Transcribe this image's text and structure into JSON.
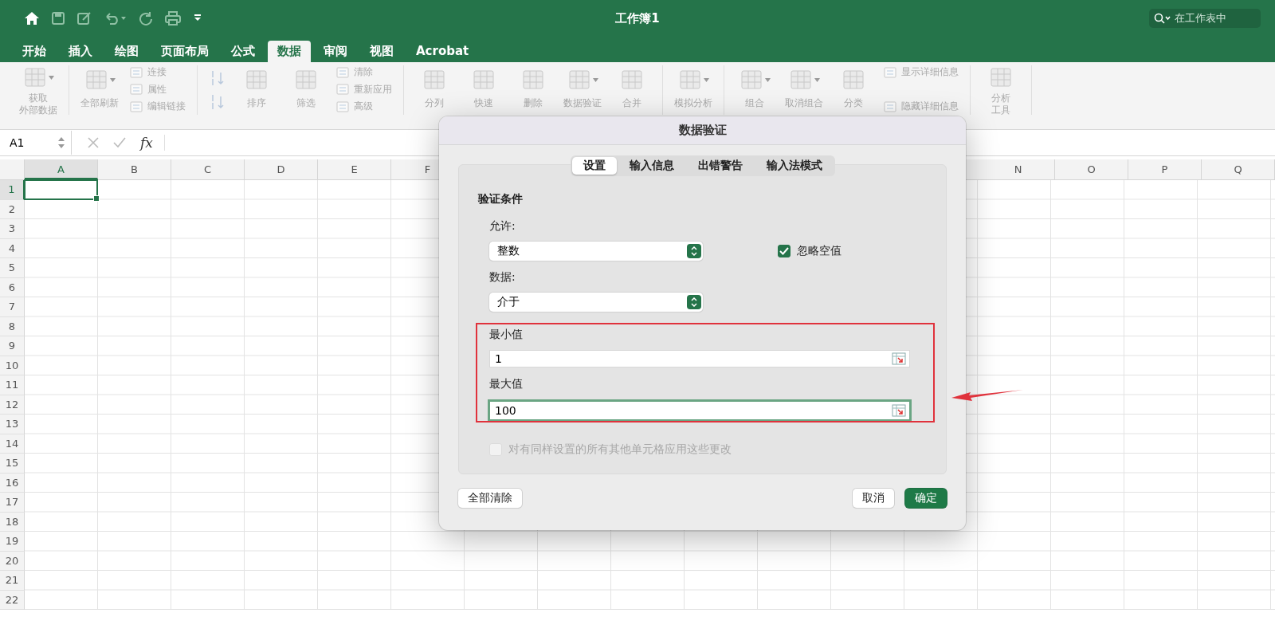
{
  "window": {
    "title": "工作簿1"
  },
  "search": {
    "placeholder": "在工作表中"
  },
  "tabs": [
    {
      "label": "开始",
      "selected": false
    },
    {
      "label": "插入",
      "selected": false
    },
    {
      "label": "绘图",
      "selected": false
    },
    {
      "label": "页面布局",
      "selected": false
    },
    {
      "label": "公式",
      "selected": false
    },
    {
      "label": "数据",
      "selected": true
    },
    {
      "label": "审阅",
      "selected": false
    },
    {
      "label": "视图",
      "selected": false
    },
    {
      "label": "Acrobat",
      "selected": false
    }
  ],
  "ribbon": {
    "disabled": true,
    "groups": [
      {
        "items": [
          {
            "kind": "large",
            "lines": [
              "获取",
              "外部数据"
            ],
            "menu": true
          }
        ]
      },
      {
        "items": [
          {
            "kind": "large",
            "lines": [
              "全部刷新"
            ],
            "menu": true
          },
          {
            "kind": "stack",
            "items": [
              "连接",
              "属性",
              "编辑链接"
            ]
          }
        ]
      },
      {
        "items": [
          {
            "kind": "sort-icons"
          },
          {
            "kind": "large",
            "lines": [
              "排序"
            ]
          },
          {
            "kind": "large",
            "lines": [
              "筛选"
            ]
          },
          {
            "kind": "stack",
            "items": [
              "清除",
              "重新应用",
              "高级"
            ]
          }
        ]
      },
      {
        "items": [
          {
            "kind": "large",
            "lines": [
              "分列"
            ]
          },
          {
            "kind": "large",
            "lines": [
              "快速"
            ]
          },
          {
            "kind": "large",
            "lines": [
              "删除"
            ]
          },
          {
            "kind": "large",
            "lines": [
              "数据验证"
            ],
            "menu": true
          },
          {
            "kind": "large",
            "lines": [
              "合并"
            ]
          }
        ]
      },
      {
        "items": [
          {
            "kind": "large",
            "lines": [
              "模拟分析"
            ],
            "menu": true
          }
        ]
      },
      {
        "items": [
          {
            "kind": "large",
            "lines": [
              "组合"
            ],
            "menu": true
          },
          {
            "kind": "large",
            "lines": [
              "取消组合"
            ],
            "menu": true
          },
          {
            "kind": "large",
            "lines": [
              "分类"
            ]
          },
          {
            "kind": "stack",
            "items": [
              "显示详细信息",
              "隐藏详细信息"
            ]
          }
        ]
      },
      {
        "items": [
          {
            "kind": "large",
            "lines": [
              "分析",
              "工具"
            ]
          }
        ]
      }
    ]
  },
  "formula_bar": {
    "name_box": "A1",
    "function_label": "fx"
  },
  "sheet": {
    "columns_left": [
      {
        "label": "A",
        "selected": true
      },
      {
        "label": "B",
        "selected": false
      },
      {
        "label": "C",
        "selected": false
      },
      {
        "label": "D",
        "selected": false
      },
      {
        "label": "E",
        "selected": false
      },
      {
        "label": "F",
        "selected": false
      }
    ],
    "columns_right": [
      {
        "label": "N",
        "selected": false
      },
      {
        "label": "O",
        "selected": false
      },
      {
        "label": "P",
        "selected": false
      },
      {
        "label": "Q",
        "selected": false
      }
    ],
    "rows": [
      {
        "label": "1",
        "selected": true
      },
      {
        "label": "2",
        "selected": false
      },
      {
        "label": "3",
        "selected": false
      },
      {
        "label": "4",
        "selected": false
      },
      {
        "label": "5",
        "selected": false
      },
      {
        "label": "6",
        "selected": false
      },
      {
        "label": "7",
        "selected": false
      },
      {
        "label": "8",
        "selected": false
      },
      {
        "label": "9",
        "selected": false
      },
      {
        "label": "10",
        "selected": false
      },
      {
        "label": "11",
        "selected": false
      },
      {
        "label": "12",
        "selected": false
      },
      {
        "label": "13",
        "selected": false
      },
      {
        "label": "14",
        "selected": false
      },
      {
        "label": "15",
        "selected": false
      },
      {
        "label": "16",
        "selected": false
      },
      {
        "label": "17",
        "selected": false
      },
      {
        "label": "18",
        "selected": false
      },
      {
        "label": "19",
        "selected": false
      },
      {
        "label": "20",
        "selected": false
      },
      {
        "label": "21",
        "selected": false
      },
      {
        "label": "22",
        "selected": false
      }
    ]
  },
  "dialog": {
    "title": "数据验证",
    "tabs": [
      {
        "label": "设置",
        "selected": true
      },
      {
        "label": "输入信息",
        "selected": false
      },
      {
        "label": "出错警告",
        "selected": false
      },
      {
        "label": "输入法模式",
        "selected": false
      }
    ],
    "section_title": "验证条件",
    "allow": {
      "label": "允许:",
      "value": "整数"
    },
    "ignore_blank": {
      "label": "忽略空值",
      "checked": true
    },
    "data": {
      "label": "数据:",
      "value": "介于"
    },
    "min": {
      "label": "最小值",
      "value": "1",
      "focused": false
    },
    "max": {
      "label": "最大值",
      "value": "100",
      "focused": true
    },
    "apply_all": {
      "label": "对有同样设置的所有其他单元格应用这些更改",
      "checked": false,
      "disabled": true
    },
    "buttons": [
      {
        "label": "全部清除",
        "primary": false
      },
      {
        "label": "取消",
        "primary": false
      },
      {
        "label": "确定",
        "primary": true
      }
    ]
  }
}
